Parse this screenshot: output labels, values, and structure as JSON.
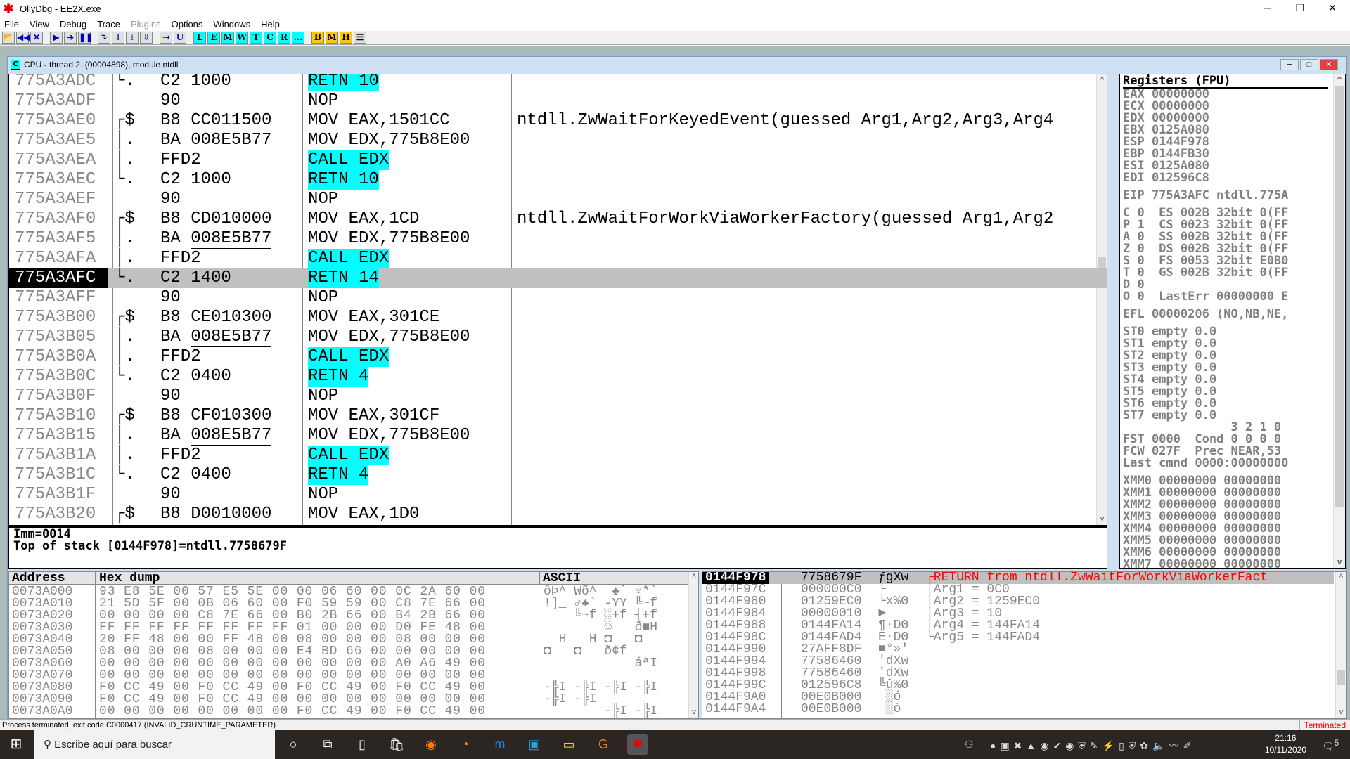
{
  "window": {
    "title": "OllyDbg - EE2X.exe",
    "minimize": "─",
    "restore": "❐",
    "close": "✕"
  },
  "menu": [
    "File",
    "View",
    "Debug",
    "Trace",
    "Plugins",
    "Options",
    "Windows",
    "Help"
  ],
  "toolbar": {
    "controls": [
      {
        "icon": "open-icon",
        "glyph": "📂"
      },
      {
        "icon": "rewind-icon",
        "glyph": "◀◀"
      },
      {
        "icon": "close-icon",
        "glyph": "✕"
      },
      {
        "icon": "run-icon",
        "glyph": "▶"
      },
      {
        "icon": "run-thread-icon",
        "glyph": "➔"
      },
      {
        "icon": "pause-icon",
        "glyph": "❚❚"
      },
      {
        "icon": "step-into-icon",
        "glyph": "↴"
      },
      {
        "icon": "step-over-icon",
        "glyph": "↓"
      },
      {
        "icon": "trace-into-icon",
        "glyph": "⇣"
      },
      {
        "icon": "trace-over-icon",
        "glyph": "⇩"
      },
      {
        "icon": "execute-till-return-icon",
        "glyph": "⇥"
      },
      {
        "icon": "execute-till-user-code-icon",
        "glyph": "U"
      }
    ],
    "windows": [
      "L",
      "E",
      "M",
      "W",
      "T",
      "C",
      "R",
      "..."
    ],
    "windows2": [
      "B",
      "M",
      "H"
    ],
    "list_icon": "☰"
  },
  "cpu": {
    "title": "CPU - thread 2. (00004898), module ntdll",
    "icon_letter": "C",
    "disasm": [
      {
        "addr": "775A3ADC",
        "br": "└.",
        "op": "C2",
        "arg": "1000",
        "u": false,
        "asm": "RETN 10",
        "hl": true,
        "cm": ""
      },
      {
        "addr": "775A3ADF",
        "br": "",
        "op": "90",
        "arg": "",
        "u": false,
        "asm": "NOP",
        "hl": false,
        "cm": ""
      },
      {
        "addr": "775A3AE0",
        "br": "┌$",
        "op": "B8",
        "arg": "CC011500",
        "u": false,
        "asm": "MOV EAX,1501CC",
        "hl": false,
        "cm": "ntdll.ZwWaitForKeyedEvent(guessed Arg1,Arg2,Arg3,Arg4"
      },
      {
        "addr": "775A3AE5",
        "br": "│.",
        "op": "BA",
        "arg": "008E5B77",
        "u": true,
        "asm": "MOV EDX,775B8E00",
        "hl": false,
        "cm": ""
      },
      {
        "addr": "775A3AEA",
        "br": "│.",
        "op": "FFD2",
        "arg": "",
        "u": false,
        "asm": "CALL EDX",
        "hl": true,
        "cm": ""
      },
      {
        "addr": "775A3AEC",
        "br": "└.",
        "op": "C2",
        "arg": "1000",
        "u": false,
        "asm": "RETN 10",
        "hl": true,
        "cm": ""
      },
      {
        "addr": "775A3AEF",
        "br": "",
        "op": "90",
        "arg": "",
        "u": false,
        "asm": "NOP",
        "hl": false,
        "cm": ""
      },
      {
        "addr": "775A3AF0",
        "br": "┌$",
        "op": "B8",
        "arg": "CD010000",
        "u": false,
        "asm": "MOV EAX,1CD",
        "hl": false,
        "cm": "ntdll.ZwWaitForWorkViaWorkerFactory(guessed Arg1,Arg2"
      },
      {
        "addr": "775A3AF5",
        "br": "│.",
        "op": "BA",
        "arg": "008E5B77",
        "u": true,
        "asm": "MOV EDX,775B8E00",
        "hl": false,
        "cm": ""
      },
      {
        "addr": "775A3AFA",
        "br": "│.",
        "op": "FFD2",
        "arg": "",
        "u": false,
        "asm": "CALL EDX",
        "hl": true,
        "cm": ""
      },
      {
        "addr": "775A3AFC",
        "br": "└.",
        "op": "C2",
        "arg": "1400",
        "u": false,
        "asm": "RETN 14",
        "hl": true,
        "cm": "",
        "sel": true
      },
      {
        "addr": "775A3AFF",
        "br": "",
        "op": "90",
        "arg": "",
        "u": false,
        "asm": "NOP",
        "hl": false,
        "cm": ""
      },
      {
        "addr": "775A3B00",
        "br": "┌$",
        "op": "B8",
        "arg": "CE010300",
        "u": false,
        "asm": "MOV EAX,301CE",
        "hl": false,
        "cm": ""
      },
      {
        "addr": "775A3B05",
        "br": "│.",
        "op": "BA",
        "arg": "008E5B77",
        "u": true,
        "asm": "MOV EDX,775B8E00",
        "hl": false,
        "cm": ""
      },
      {
        "addr": "775A3B0A",
        "br": "│.",
        "op": "FFD2",
        "arg": "",
        "u": false,
        "asm": "CALL EDX",
        "hl": true,
        "cm": ""
      },
      {
        "addr": "775A3B0C",
        "br": "└.",
        "op": "C2",
        "arg": "0400",
        "u": false,
        "asm": "RETN 4",
        "hl": true,
        "cm": ""
      },
      {
        "addr": "775A3B0F",
        "br": "",
        "op": "90",
        "arg": "",
        "u": false,
        "asm": "NOP",
        "hl": false,
        "cm": ""
      },
      {
        "addr": "775A3B10",
        "br": "┌$",
        "op": "B8",
        "arg": "CF010300",
        "u": false,
        "asm": "MOV EAX,301CF",
        "hl": false,
        "cm": ""
      },
      {
        "addr": "775A3B15",
        "br": "│.",
        "op": "BA",
        "arg": "008E5B77",
        "u": true,
        "asm": "MOV EDX,775B8E00",
        "hl": false,
        "cm": ""
      },
      {
        "addr": "775A3B1A",
        "br": "│.",
        "op": "FFD2",
        "arg": "",
        "u": false,
        "asm": "CALL EDX",
        "hl": true,
        "cm": ""
      },
      {
        "addr": "775A3B1C",
        "br": "└.",
        "op": "C2",
        "arg": "0400",
        "u": false,
        "asm": "RETN 4",
        "hl": true,
        "cm": ""
      },
      {
        "addr": "775A3B1F",
        "br": "",
        "op": "90",
        "arg": "",
        "u": false,
        "asm": "NOP",
        "hl": false,
        "cm": ""
      },
      {
        "addr": "775A3B20",
        "br": "┌$",
        "op": "B8",
        "arg": "D0010000",
        "u": false,
        "asm": "MOV EAX,1D0",
        "hl": false,
        "cm": ""
      }
    ],
    "info": [
      "Imm=0014",
      "Top of stack [0144F978]=ntdll.7758679F"
    ],
    "registers": {
      "header": "Registers (FPU)",
      "lines": [
        [
          "EAX 00000000",
          "ECX 00000000",
          "EDX 00000000",
          "EBX 0125A080",
          "ESP 0144F978",
          "EBP 0144FB30",
          "ESI 0125A080",
          "EDI 012596C8"
        ],
        [
          "EIP 775A3AFC ntdll.775A"
        ],
        [
          "C 0  ES 002B 32bit 0(FF",
          "P 1  CS 0023 32bit 0(FF",
          "A 0  SS 002B 32bit 0(FF",
          "Z 0  DS 002B 32bit 0(FF",
          "S 0  FS 0053 32bit E0B0",
          "T 0  GS 002B 32bit 0(FF",
          "D 0",
          "O 0  LastErr 00000000 E"
        ],
        [
          "EFL 00000206 (NO,NB,NE,"
        ],
        [
          "ST0 empty 0.0",
          "ST1 empty 0.0",
          "ST2 empty 0.0",
          "ST3 empty 0.0",
          "ST4 empty 0.0",
          "ST5 empty 0.0",
          "ST6 empty 0.0",
          "ST7 empty 0.0",
          "               3 2 1 0",
          "FST 0000  Cond 0 0 0 0",
          "FCW 027F  Prec NEAR,53",
          "Last cmnd 0000:00000000"
        ],
        [
          "XMM0 00000000 00000000",
          "XMM1 00000000 00000000",
          "XMM2 00000000 00000000",
          "XMM3 00000000 00000000",
          "XMM4 00000000 00000000",
          "XMM5 00000000 00000000",
          "XMM6 00000000 00000000",
          "XMM7 00000000 00000000"
        ]
      ]
    },
    "dump": {
      "headers": [
        "Address",
        "Hex dump",
        "ASCII"
      ],
      "rows": [
        [
          "0073A000",
          "93 E8 5E 00 57 E5 5E 00 00 06 60 00 0C 2A 60 00",
          "ôÞ^ Wõ^  ♠` ♀*`"
        ],
        [
          "0073A010",
          "21 5D 5F 00 0B 06 60 00 F0 59 59 00 C8 7E 66 00",
          "!]_ ♂♠` -YY ╚~f"
        ],
        [
          "0073A020",
          "00 00 00 00 C8 7E 66 00 B0 2B 66 00 B4 2B 66 00",
          "    ╚~f ░+f ┤+f"
        ],
        [
          "0073A030",
          "FF FF FF FF FF FF FF FF 01 00 00 00 D0 FE 48 00",
          "        ☺   ð■H"
        ],
        [
          "0073A040",
          "20 FF 48 00 00 FF 48 00 08 00 00 00 08 00 00 00",
          "  H   H ◘   ◘"
        ],
        [
          "0073A050",
          "08 00 00 00 08 00 00 00 E4 BD 66 00 00 00 00 00",
          "◘   ◘   õ¢f"
        ],
        [
          "0073A060",
          "00 00 00 00 00 00 00 00 00 00 00 00 A0 A6 49 00",
          "            áªI"
        ],
        [
          "0073A070",
          "00 00 00 00 00 00 00 00 00 00 00 00 00 00 00 00",
          ""
        ],
        [
          "0073A080",
          "F0 CC 49 00 F0 CC 49 00 F0 CC 49 00 F0 CC 49 00",
          "-╠I -╠I -╠I -╠I"
        ],
        [
          "0073A090",
          "F0 CC 49 00 F0 CC 49 00 00 00 00 00 00 00 00 00",
          "-╠I -╠I"
        ],
        [
          "0073A0A0",
          "00 00 00 00 00 00 00 00 F0 CC 49 00 F0 CC 49 00",
          "        -╠I -╠I"
        ]
      ]
    },
    "stack": {
      "rows": [
        [
          "0144F978",
          "7758679F",
          "ƒgXw",
          "┌RETURN from ntdll.ZwWaitForWorkViaWorkerFact"
        ],
        [
          "0144F97C",
          "000000C0",
          "└",
          "│Arg1 = 0C0"
        ],
        [
          "0144F980",
          "01259EC0",
          "└x%Θ",
          "│Arg2 = 1259EC0"
        ],
        [
          "0144F984",
          "00000010",
          "►",
          "│Arg3 = 10"
        ],
        [
          "0144F988",
          "0144FA14",
          "¶·DΘ",
          "│Arg4 = 144FA14"
        ],
        [
          "0144F98C",
          "0144FAD4",
          "È·DΘ",
          "└Arg5 = 144FAD4"
        ],
        [
          "0144F990",
          "27AFF8DF",
          "■°»'",
          ""
        ],
        [
          "0144F994",
          "77586460",
          "'dXw",
          ""
        ],
        [
          "0144F998",
          "77586460",
          "'dXw",
          ""
        ],
        [
          "0144F99C",
          "012596C8",
          "╚û%Θ",
          ""
        ],
        [
          "0144F9A0",
          "00E0B000",
          " ░ó",
          ""
        ],
        [
          "0144F9A4",
          "00E0B000",
          " ░ó",
          ""
        ]
      ]
    }
  },
  "status": {
    "message": "Process terminated, exit code C0000417 (INVALID_CRUNTIME_PARAMETER)",
    "state": "Terminated"
  },
  "taskbar": {
    "search_placeholder": "Escribe aquí para buscar",
    "apps": [
      "cortana",
      "task-view",
      "notepad",
      "store",
      "firefox",
      "blender",
      "musescore",
      "control-panel",
      "file-explorer",
      "pdf-app",
      "ollydbg"
    ],
    "time": "21:16",
    "date": "10/11/2020",
    "notifications": "5"
  },
  "colors": {
    "highlight": "#00ffff",
    "terminated": "#ff0000",
    "stack_comment": "#ff0000",
    "toolbar_yellow": "#ffc800"
  }
}
